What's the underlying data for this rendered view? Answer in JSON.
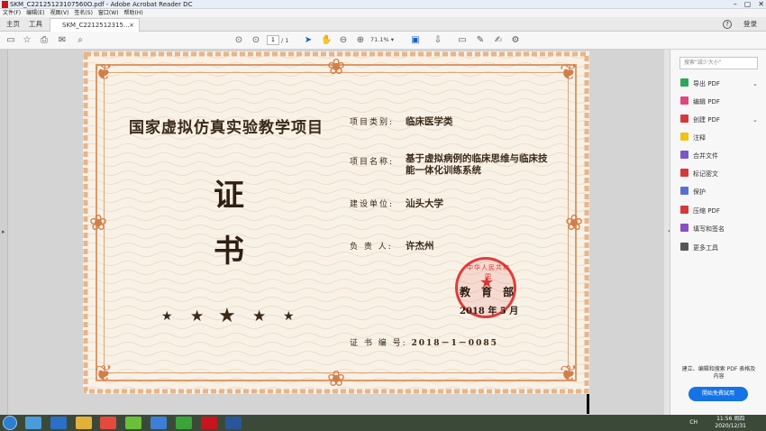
{
  "window": {
    "title": "SKM_C22125123107560O.pdf - Adobe Acrobat Reader DC",
    "controls": [
      "–",
      "▢",
      "✕"
    ]
  },
  "menubar": [
    "文件(F)",
    "编辑(E)",
    "视图(V)",
    "签名(S)",
    "窗口(W)",
    "帮助(H)"
  ],
  "tabs": {
    "home": "主页",
    "tools": "工具",
    "document": "SKM_C2212512315...",
    "close": "×",
    "help": "?",
    "login": "登录"
  },
  "toolbar": {
    "page_current": "1",
    "page_total": "/ 1",
    "zoom": "71.1%"
  },
  "certificate": {
    "title": "国家虚拟仿真实验教学项目",
    "char_1": "证",
    "char_2": "书",
    "stars": [
      "★",
      "★",
      "★",
      "★",
      "★"
    ],
    "category_label": "项目类别:",
    "category_value": "临床医学类",
    "name_label": "项目名称:",
    "name_value": "基于虚拟病例的临床思维与临床技能一体化训练系统",
    "unit_label": "建设单位:",
    "unit_value": "汕头大学",
    "person_label": "负 责 人:",
    "person_value": "许杰州",
    "seal_text": "中华人民共和国",
    "issuer": "教育部",
    "date": "2018 年 5 月",
    "cert_no_label": "证 书 编 号:",
    "cert_no_value": "2018－1－0085"
  },
  "sidepanel": {
    "search_placeholder": "搜索\"减少大小\"",
    "tools": [
      {
        "label": "导出 PDF",
        "color": "#2fa55a",
        "icon": "export-pdf-icon"
      },
      {
        "label": "编辑 PDF",
        "color": "#e0457b",
        "icon": "edit-pdf-icon"
      },
      {
        "label": "创建 PDF",
        "color": "#d6393b",
        "icon": "create-pdf-icon"
      },
      {
        "label": "注释",
        "color": "#f2c21b",
        "icon": "comment-icon"
      },
      {
        "label": "合并文件",
        "color": "#7a57c9",
        "icon": "combine-files-icon"
      },
      {
        "label": "标记密文",
        "color": "#d6393b",
        "icon": "redact-icon"
      },
      {
        "label": "保护",
        "color": "#5b6fd1",
        "icon": "protect-icon"
      },
      {
        "label": "压缩 PDF",
        "color": "#d6393b",
        "icon": "compress-pdf-icon"
      },
      {
        "label": "填写和签名",
        "color": "#8a4fc2",
        "icon": "fill-sign-icon"
      },
      {
        "label": "更多工具",
        "color": "#555555",
        "icon": "more-tools-icon"
      }
    ],
    "promo_text": "建立、编辑和搜索 PDF 表格及内容",
    "promo_button": "開始免費試用"
  },
  "taskbar": {
    "lang": "CH",
    "time": "11:56 周四",
    "date": "2020/12/31"
  }
}
